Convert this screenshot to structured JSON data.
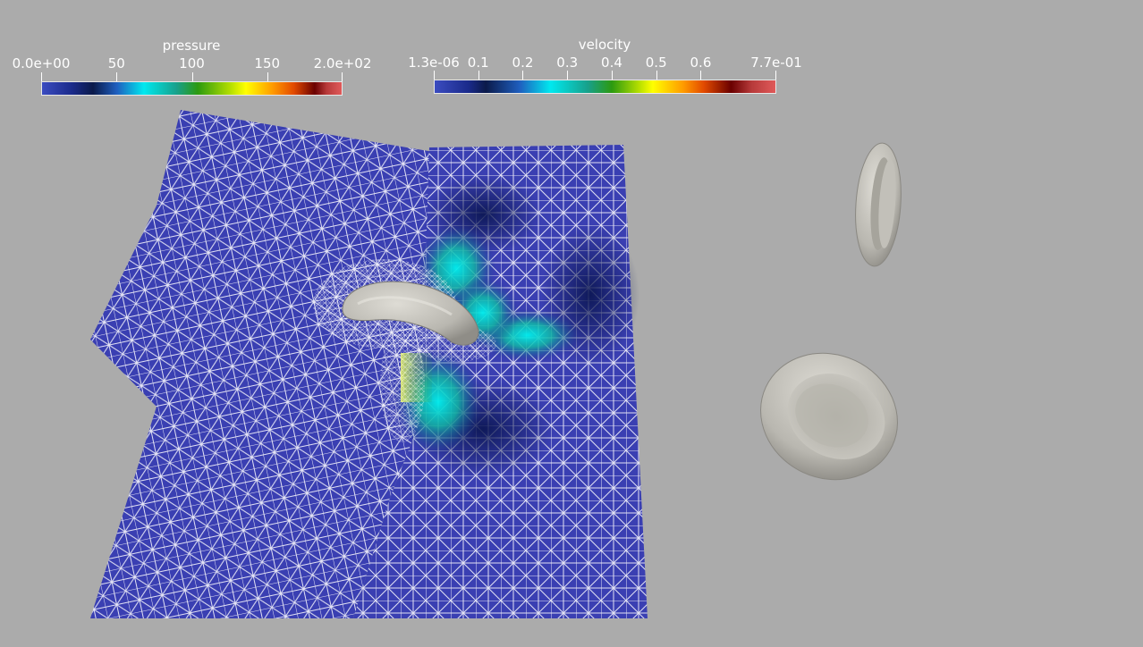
{
  "colors": {
    "background": "#ababab",
    "mesh_base": "#3a3fb0",
    "mesh_wire": "#ffffff",
    "cell_surface": "#c9c7c0"
  },
  "pressure_bar": {
    "title": "pressure",
    "range": [
      0,
      200
    ],
    "labels": [
      {
        "text": "0.0e+00",
        "value": 0
      },
      {
        "text": "50",
        "value": 50
      },
      {
        "text": "100",
        "value": 100
      },
      {
        "text": "150",
        "value": 150
      },
      {
        "text": "2.0e+02",
        "value": 200
      }
    ],
    "colormap": "jet-like (blue → cyan → green → yellow → red)"
  },
  "velocity_bar": {
    "title": "velocity",
    "range": [
      1.3e-06,
      0.77
    ],
    "labels": [
      {
        "text": "1.3e-06",
        "value": 1.3e-06
      },
      {
        "text": "0.1",
        "value": 0.1
      },
      {
        "text": "0.2",
        "value": 0.2
      },
      {
        "text": "0.3",
        "value": 0.3
      },
      {
        "text": "0.4",
        "value": 0.4
      },
      {
        "text": "0.5",
        "value": 0.5
      },
      {
        "text": "0.6",
        "value": 0.6
      },
      {
        "text": "7.7e-01",
        "value": 0.77
      }
    ],
    "colormap": "jet-like (blue → cyan → green → yellow → red)"
  },
  "scene": {
    "objects": [
      "pressure-mesh-slice",
      "velocity-mesh-slice",
      "deformed-red-blood-cell",
      "red-blood-cell-edge-on",
      "red-blood-cell-tilted"
    ]
  }
}
